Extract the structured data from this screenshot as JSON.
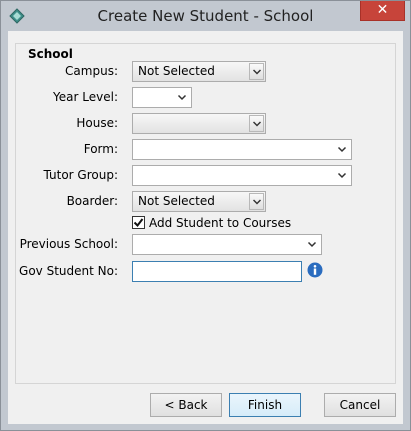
{
  "window": {
    "title": "Create New Student - School",
    "close_glyph": "✕"
  },
  "group": {
    "title": "School"
  },
  "fields": {
    "campus": {
      "label": "Campus:",
      "value": "Not Selected"
    },
    "year_level": {
      "label": "Year Level:",
      "value": ""
    },
    "house": {
      "label": "House:",
      "value": ""
    },
    "form": {
      "label": "Form:",
      "value": ""
    },
    "tutor_group": {
      "label": "Tutor Group:",
      "value": ""
    },
    "boarder": {
      "label": "Boarder:",
      "value": "Not Selected"
    },
    "add_to_courses": {
      "label": "Add Student to Courses",
      "checked": true
    },
    "previous_school": {
      "label": "Previous School:",
      "value": ""
    },
    "gov_student_no": {
      "label": "Gov Student No:",
      "value": ""
    }
  },
  "buttons": {
    "back": "< Back",
    "finish": "Finish",
    "cancel": "Cancel"
  },
  "colors": {
    "accent": "#3c7fb1",
    "close": "#c7443a",
    "info": "#2a6cbf"
  }
}
